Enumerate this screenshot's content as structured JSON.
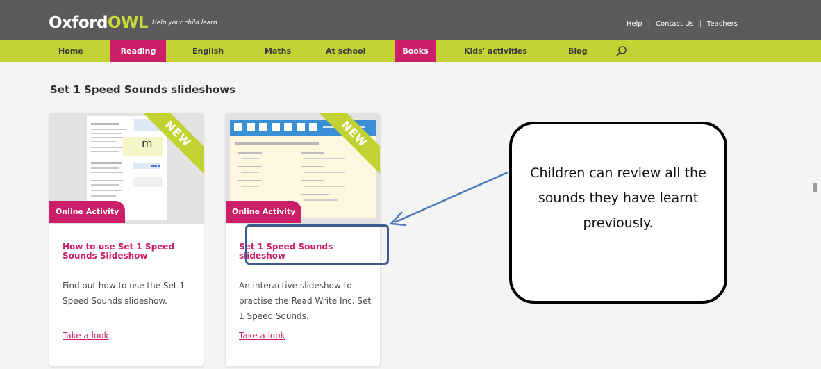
{
  "header": {
    "logo_prefix": "Oxford",
    "logo_suffix": "OWL",
    "tagline": "Help your child learn",
    "links": [
      "Help",
      "Contact Us",
      "Teachers"
    ],
    "separator": "|"
  },
  "nav": {
    "items": [
      {
        "label": "Home",
        "active": false
      },
      {
        "label": "Reading",
        "active": true
      },
      {
        "label": "English",
        "active": false
      },
      {
        "label": "Maths",
        "active": false
      },
      {
        "label": "At school",
        "active": false
      },
      {
        "label": "Books",
        "active": true
      },
      {
        "label": "Kids' activities",
        "active": false
      },
      {
        "label": "Blog",
        "active": false
      }
    ],
    "search_icon": "search-icon"
  },
  "section": {
    "title": "Set 1 Speed Sounds slideshows"
  },
  "cards": [
    {
      "ribbon": "NEW",
      "badge": "Online Activity",
      "title": "How to use Set 1 Speed Sounds Slideshow",
      "description": "Find out how to use the Set 1 Speed Sounds slideshow.",
      "link": "Take a look",
      "thumb_letter": "m"
    },
    {
      "ribbon": "NEW",
      "badge": "Online Activity",
      "title": "Set 1 Speed Sounds slideshow",
      "description": "An interactive slideshow to practise the Read Write Inc. Set 1 Speed Sounds.",
      "link": "Take a look"
    }
  ],
  "callout": {
    "text": "Children can review all the sounds they have learnt previously."
  },
  "colors": {
    "topbar": "#5b5b5b",
    "navbar": "#c3d233",
    "accent_pink": "#cc1f6a",
    "owl_green": "#c8d93a",
    "annotation_blue": "#3f5a8c",
    "arrow_blue": "#4a78b8"
  }
}
